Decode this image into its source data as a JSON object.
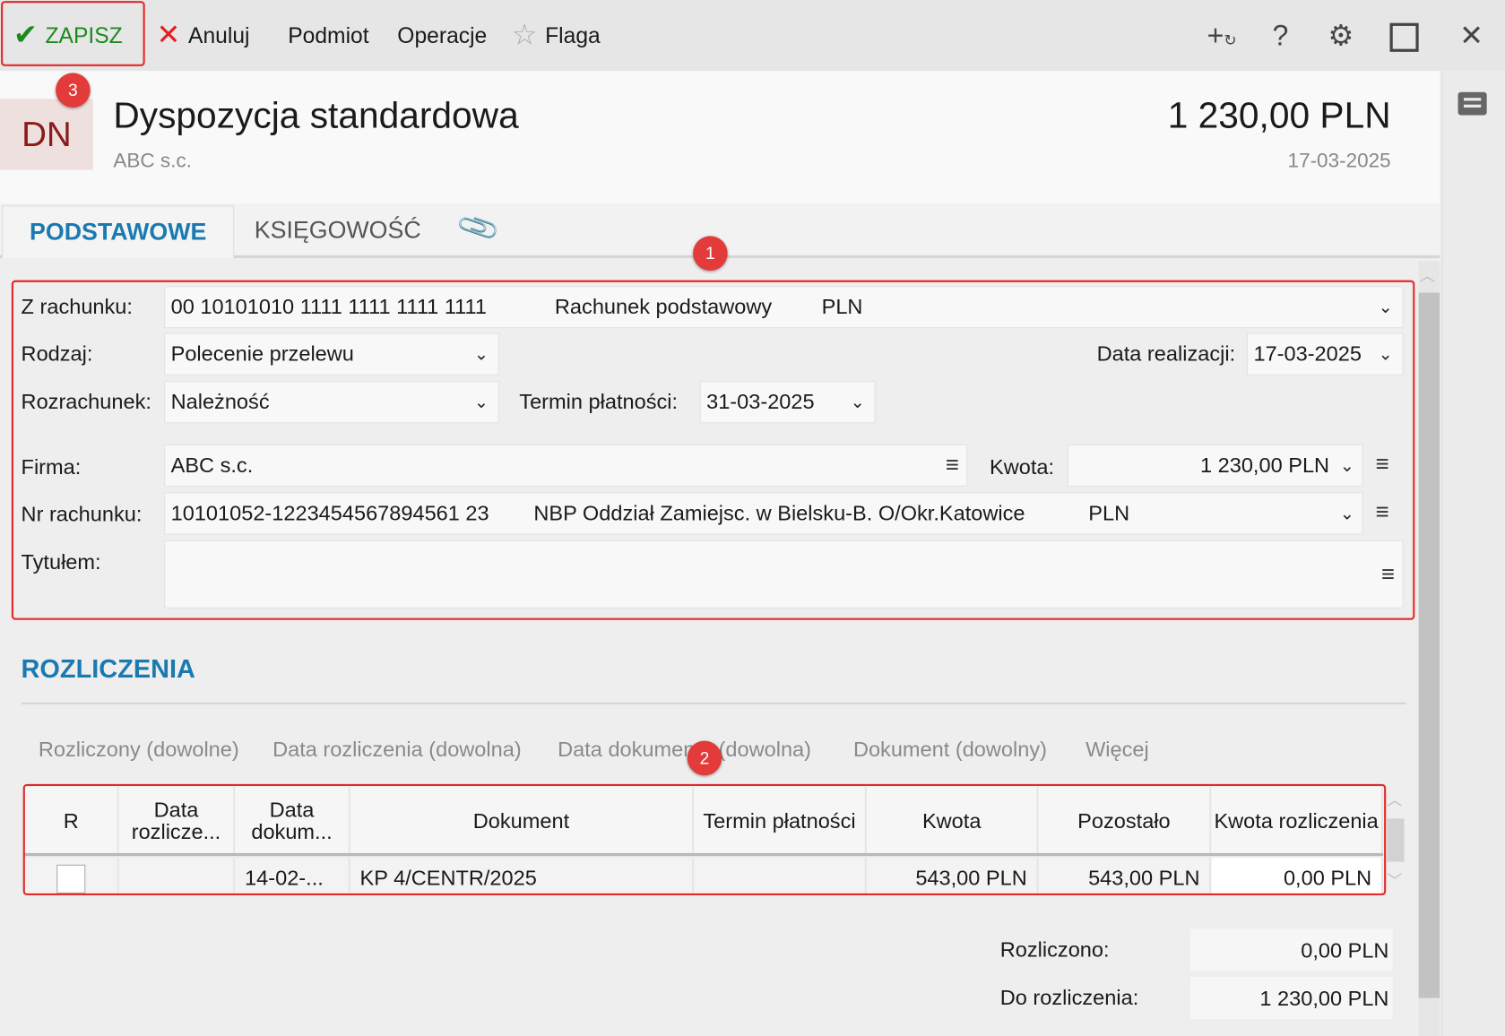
{
  "toolbar": {
    "save": "ZAPISZ",
    "cancel": "Anuluj",
    "subject": "Podmiot",
    "operations": "Operacje",
    "flag": "Flaga"
  },
  "header": {
    "badge": "DN",
    "title": "Dyspozycja standardowa",
    "company": "ABC s.c.",
    "amount": "1 230,00 PLN",
    "date": "17-03-2025"
  },
  "tabs": [
    {
      "label": "PODSTAWOWE",
      "active": true
    },
    {
      "label": "KSIĘGOWOŚĆ",
      "active": false
    }
  ],
  "form": {
    "account_label": "Z rachunku:",
    "account_number": "00 10101010 1111 1111 1111 1111",
    "account_name": "Rachunek podstawowy",
    "account_currency": "PLN",
    "type_label": "Rodzaj:",
    "type_value": "Polecenie przelewu",
    "exec_date_label": "Data realizacji:",
    "exec_date_value": "17-03-2025",
    "settlement_label": "Rozrachunek:",
    "settlement_value": "Należność",
    "due_label": "Termin płatności:",
    "due_value": "31-03-2025",
    "company_label": "Firma:",
    "company_value": "ABC s.c.",
    "amount_label": "Kwota:",
    "amount_value": "1 230,00 PLN",
    "bank_label": "Nr rachunku:",
    "bank_number": "10101052-1223454567894561 23",
    "bank_name": "NBP Oddział Zamiejsc. w Bielsku-B.  O/Okr.Katowice",
    "bank_currency": "PLN",
    "title_label": "Tytułem:",
    "title_value": ""
  },
  "settlements": {
    "heading": "ROZLICZENIA",
    "filters": [
      "Rozliczony (dowolne)",
      "Data rozliczenia (dowolna)",
      "Data dokumentu (dowolna)",
      "Dokument (dowolny)",
      "Więcej"
    ],
    "columns": [
      "R",
      "Data rozlicze...",
      "Data dokum...",
      "Dokument",
      "Termin płatności",
      "Kwota",
      "Pozostało",
      "Kwota rozliczenia"
    ],
    "rows": [
      {
        "checked": false,
        "settle_date": "",
        "doc_date": "14-02-...",
        "document": "KP 4/CENTR/2025",
        "due": "",
        "amount": "543,00 PLN",
        "remaining": "543,00 PLN",
        "settle_amount": "0,00 PLN"
      }
    ],
    "settled_label": "Rozliczono:",
    "settled_value": "0,00 PLN",
    "remaining_label": "Do rozliczenia:",
    "remaining_value": "1 230,00 PLN"
  },
  "annotations": [
    "1",
    "2",
    "3"
  ],
  "colors": {
    "accent": "#1a7ab0",
    "save": "#1e8a1e",
    "annotation": "#e32a2a",
    "badge_text": "#8b1a1a"
  }
}
